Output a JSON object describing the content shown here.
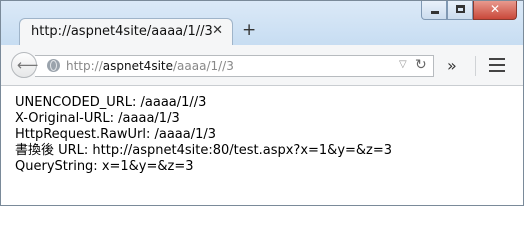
{
  "window": {
    "minimize_icon": "minimize-icon",
    "maximize_icon": "maximize-icon",
    "close_glyph": "✕"
  },
  "tab": {
    "title": "http://aspnet4site/aaaa/1//3",
    "close_glyph": "✕",
    "new_tab_glyph": "+"
  },
  "toolbar": {
    "back_glyph": "⟵",
    "url_scheme": "http://",
    "url_host": "aspnet4site",
    "url_path": "/aaaa/1//3",
    "dropdown_glyph": "▽",
    "reload_glyph": "↻",
    "overflow_glyph": "»"
  },
  "content": {
    "lines": [
      "UNENCODED_URL: /aaaa/1//3",
      "X-Original-URL: /aaaa/1/3",
      "HttpRequest.RawUrl: /aaaa/1/3",
      "書換後 URL: http://aspnet4site:80/test.aspx?x=1&y=&z=3",
      "QueryString: x=1&y=&z=3"
    ]
  }
}
